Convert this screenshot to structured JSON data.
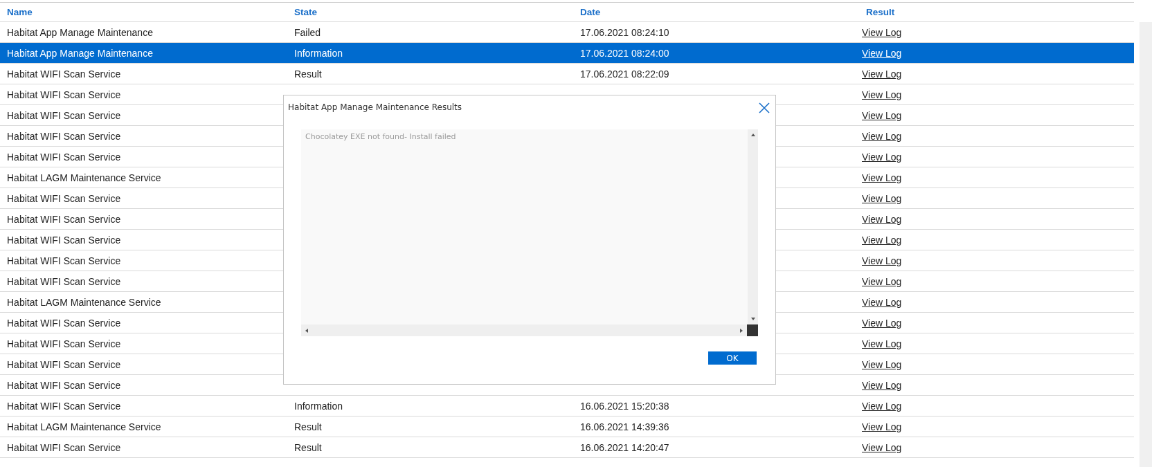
{
  "table": {
    "columns": [
      "Name",
      "State",
      "Date",
      "Result"
    ],
    "rows": [
      {
        "name": "Habitat App Manage Maintenance",
        "state": "Failed",
        "date": "17.06.2021 08:24:10",
        "result": "View Log",
        "selected": false
      },
      {
        "name": "Habitat App Manage Maintenance",
        "state": "Information",
        "date": "17.06.2021 08:24:00",
        "result": "View Log",
        "selected": true
      },
      {
        "name": "Habitat WIFI Scan Service",
        "state": "Result",
        "date": "17.06.2021 08:22:09",
        "result": "View Log",
        "selected": false
      },
      {
        "name": "Habitat WIFI Scan Service",
        "result": "View Log",
        "selected": false
      },
      {
        "name": "Habitat WIFI Scan Service",
        "result": "View Log",
        "selected": false
      },
      {
        "name": "Habitat WIFI Scan Service",
        "result": "View Log",
        "selected": false
      },
      {
        "name": "Habitat WIFI Scan Service",
        "result": "View Log",
        "selected": false
      },
      {
        "name": "Habitat LAGM Maintenance Service",
        "result": "View Log",
        "selected": false
      },
      {
        "name": "Habitat WIFI Scan Service",
        "result": "View Log",
        "selected": false
      },
      {
        "name": "Habitat WIFI Scan Service",
        "result": "View Log",
        "selected": false
      },
      {
        "name": "Habitat WIFI Scan Service",
        "result": "View Log",
        "selected": false
      },
      {
        "name": "Habitat WIFI Scan Service",
        "result": "View Log",
        "selected": false
      },
      {
        "name": "Habitat WIFI Scan Service",
        "result": "View Log",
        "selected": false
      },
      {
        "name": "Habitat LAGM Maintenance Service",
        "result": "View Log",
        "selected": false
      },
      {
        "name": "Habitat WIFI Scan Service",
        "result": "View Log",
        "selected": false
      },
      {
        "name": "Habitat WIFI Scan Service",
        "result": "View Log",
        "selected": false
      },
      {
        "name": "Habitat WIFI Scan Service",
        "result": "View Log",
        "selected": false
      },
      {
        "name": "Habitat WIFI Scan Service",
        "result": "View Log",
        "selected": false
      },
      {
        "name": "Habitat WIFI Scan Service",
        "state": "Information",
        "date": "16.06.2021 15:20:38",
        "result": "View Log",
        "selected": false
      },
      {
        "name": "Habitat LAGM Maintenance Service",
        "state": "Result",
        "date": "16.06.2021 14:39:36",
        "result": "View Log",
        "selected": false
      },
      {
        "name": "Habitat WIFI Scan Service",
        "state": "Result",
        "date": "16.06.2021 14:20:47",
        "result": "View Log",
        "selected": false
      }
    ]
  },
  "dialog": {
    "title": "Habitat App Manage Maintenance Results",
    "log_text": "Chocolatey EXE not found- Install failed",
    "ok_button": "OK"
  }
}
